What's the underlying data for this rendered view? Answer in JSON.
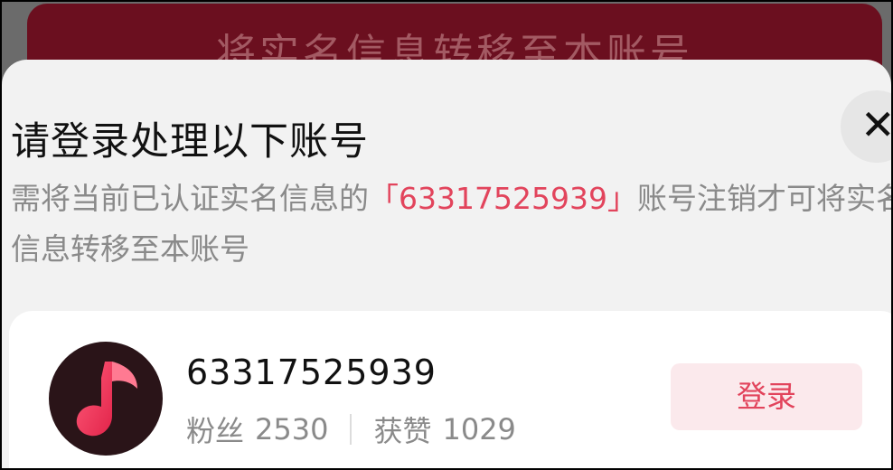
{
  "background": {
    "button_text": "将实名信息转移至本账号"
  },
  "sheet": {
    "title": "请登录处理以下账号",
    "close_icon_glyph": "✕",
    "description": {
      "prefix": "需将当前已认证实名信息的",
      "highlight": "「63317525939」",
      "suffix": "账号注销才可将实名信息转移至本账号"
    }
  },
  "account": {
    "name": "63317525939",
    "fans_label": "粉丝",
    "fans_count": "2530",
    "likes_label": "获赞",
    "likes_count": "1029",
    "login_label": "登录",
    "avatar_icon": "music-note-icon"
  },
  "colors": {
    "accent": "#e2445c",
    "login_bg": "#fbe9ec",
    "dim_button": "#6b0f1f"
  }
}
